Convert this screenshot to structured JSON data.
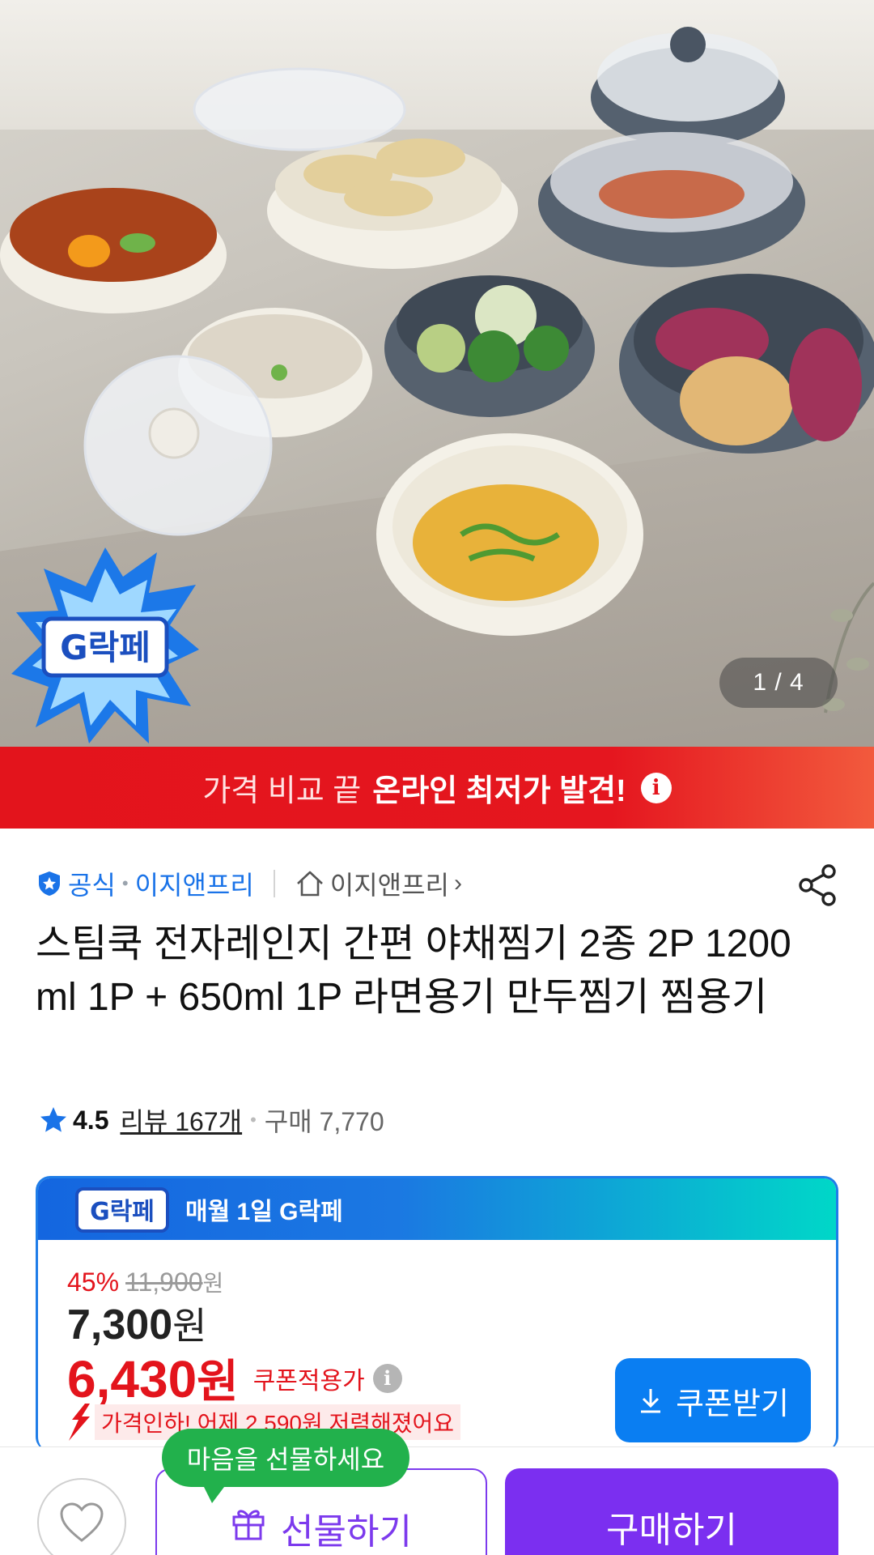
{
  "hero": {
    "image_desc_icon": "product-photo",
    "counter": "1 / 4",
    "badge_text": "G락페"
  },
  "banner": {
    "light_text": "가격 비교 끝",
    "bold_text": "온라인 최저가 발견!",
    "info_glyph": "i"
  },
  "seller": {
    "official_label": "공식",
    "seller_name": "이지앤프리",
    "store_link": "이지앤프리",
    "chevron": "›"
  },
  "product": {
    "title": "스팀쿡 전자레인지 간편 야채찜기 2종 2P 1200ml 1P + 650ml 1P 라면용기 만두찜기 찜용기"
  },
  "rating": {
    "score": "4.5",
    "reviews": "리뷰 167개",
    "purchases": "구매 7,770"
  },
  "promo": {
    "logo_text": "G락페",
    "header": "매월 1일 G락페",
    "discount_pct": "45%",
    "original_price": "11,900",
    "original_won": "원",
    "sale_price": "7,300",
    "sale_won": "원",
    "coupon_price": "6,430",
    "coupon_won": "원",
    "coupon_label": "쿠폰적용가",
    "info_glyph": "i",
    "price_drop_text": "가격인하! 어제 2,590원 저렴해졌어요",
    "coupon_button": "쿠폰받기"
  },
  "bottom": {
    "gift_tooltip": "마음을 선물하세요",
    "gift_button": "선물하기",
    "buy_button": "구매하기"
  },
  "colors": {
    "accent_purple": "#7b2ff0",
    "banner_red": "#e3141c",
    "link_blue": "#1a73e8",
    "coupon_blue": "#0a7ef2",
    "tooltip_green": "#22b14c"
  }
}
